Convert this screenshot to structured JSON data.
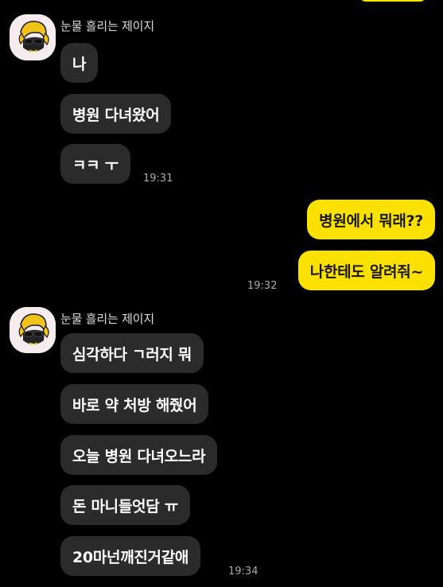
{
  "chat": {
    "colors": {
      "background": "#000000",
      "incoming_bubble": "#2b2b2b",
      "outgoing_bubble": "#fae100"
    },
    "group1": {
      "sender": "눈물 흘리는 제이지",
      "messages": [
        "나",
        "병원 다녀왔어",
        "ㅋㅋ ㅜ"
      ],
      "time": "19:31"
    },
    "outgoing": {
      "messages": [
        "병원에서 뭐래??",
        "나한테도 알려줘~"
      ],
      "time": "19:32"
    },
    "group2": {
      "sender": "눈물 흘리는 제이지",
      "messages": [
        "심각하다 ㄱ러지 뭐",
        "바로 약 처방 해줬어",
        "오늘 병원 다녀오느라",
        "돈 마니들엇담 ㅠ",
        "20마넌깨진거같애"
      ],
      "time": "19:34"
    }
  }
}
